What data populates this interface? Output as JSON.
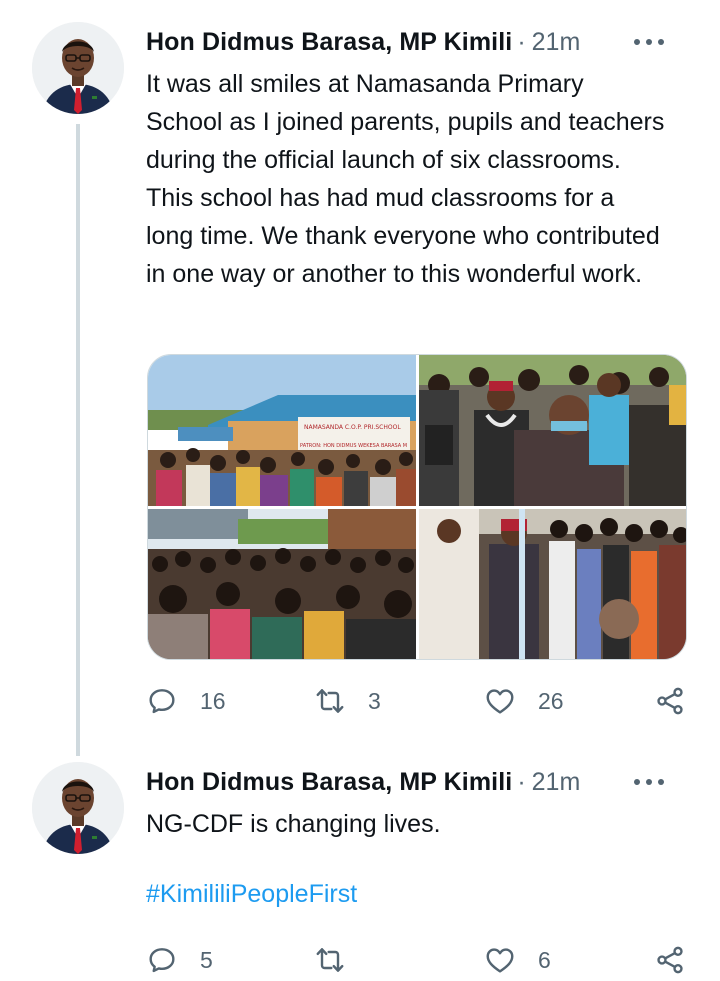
{
  "tweets": [
    {
      "author": "Hon Didmus Barasa, MP Kimili",
      "separator": "·",
      "time": "21m",
      "text": "It was all smiles at Namasanda Primary School as I joined parents, pupils and teachers during the official launch of six classrooms. This school has had mud classrooms for a long time. We thank everyone who contributed in one way or another to this wonderful work.",
      "photo_signs": [
        "NAMASANDA C.O.P. PRI.SCHOOL",
        "PATRON: HON DIDMUS WEKESA BARASA M"
      ],
      "replies": "16",
      "retweets": "3",
      "likes": "26"
    },
    {
      "author": "Hon Didmus Barasa, MP Kimili",
      "separator": "·",
      "time": "21m",
      "text": "NG-CDF is changing lives.",
      "hashtag": "#KimililiPeopleFirst",
      "replies": "5",
      "retweets": "",
      "likes": "6"
    }
  ],
  "icons": [
    "avatar",
    "more-icon",
    "reply-icon",
    "retweet-icon",
    "like-icon",
    "share-icon"
  ],
  "colors": {
    "text": "#0f1419",
    "secondary": "#536471",
    "link": "#1d9bf0",
    "thread": "#cfd9de"
  }
}
